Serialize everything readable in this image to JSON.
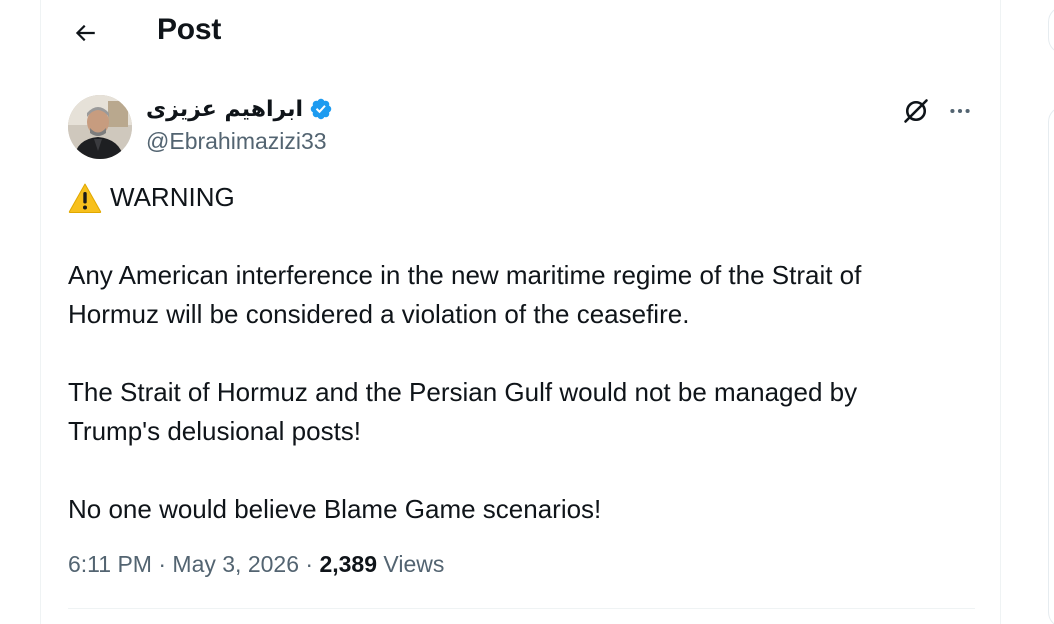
{
  "header": {
    "back_icon": "arrow-left-icon",
    "title": "Post"
  },
  "author": {
    "avatar_icon": "avatar-photo",
    "display_name": "ابراهیم عزیزی",
    "verified_icon": "verified-badge-icon",
    "verified_color": "#1d9bf0",
    "handle": "@Ebrahimazizi33"
  },
  "actions": {
    "grok_icon": "grok-icon",
    "more_icon": "more-horizontal-icon"
  },
  "tweet": {
    "warning_emoji": "warning-sign-icon",
    "warning_label": "WARNING",
    "paragraphs": [
      "Any American interference in the new maritime regime of the Strait of Hormuz will be considered a violation of the ceasefire.",
      "The Strait of Hormuz and the Persian Gulf would not be managed by Trump's delusional posts!",
      "No one would believe Blame Game scenarios!"
    ],
    "line_1": "Any American interference in the new maritime regime of the Strait of",
    "line_2": "Hormuz will be considered a violation of the ceasefire.",
    "line_3": "The Strait of Hormuz and the Persian Gulf would not be managed by",
    "line_4": "Trump's delusional posts!",
    "line_5": "No one would believe Blame Game scenarios!"
  },
  "meta": {
    "time": "6:11 PM",
    "separator": "·",
    "date": "May 3, 2026",
    "views_count": "2,389",
    "views_label": "Views"
  },
  "colors": {
    "text": "#0f1419",
    "secondary_text": "#536471",
    "border": "#eff3f4",
    "accent": "#1d9bf0"
  }
}
